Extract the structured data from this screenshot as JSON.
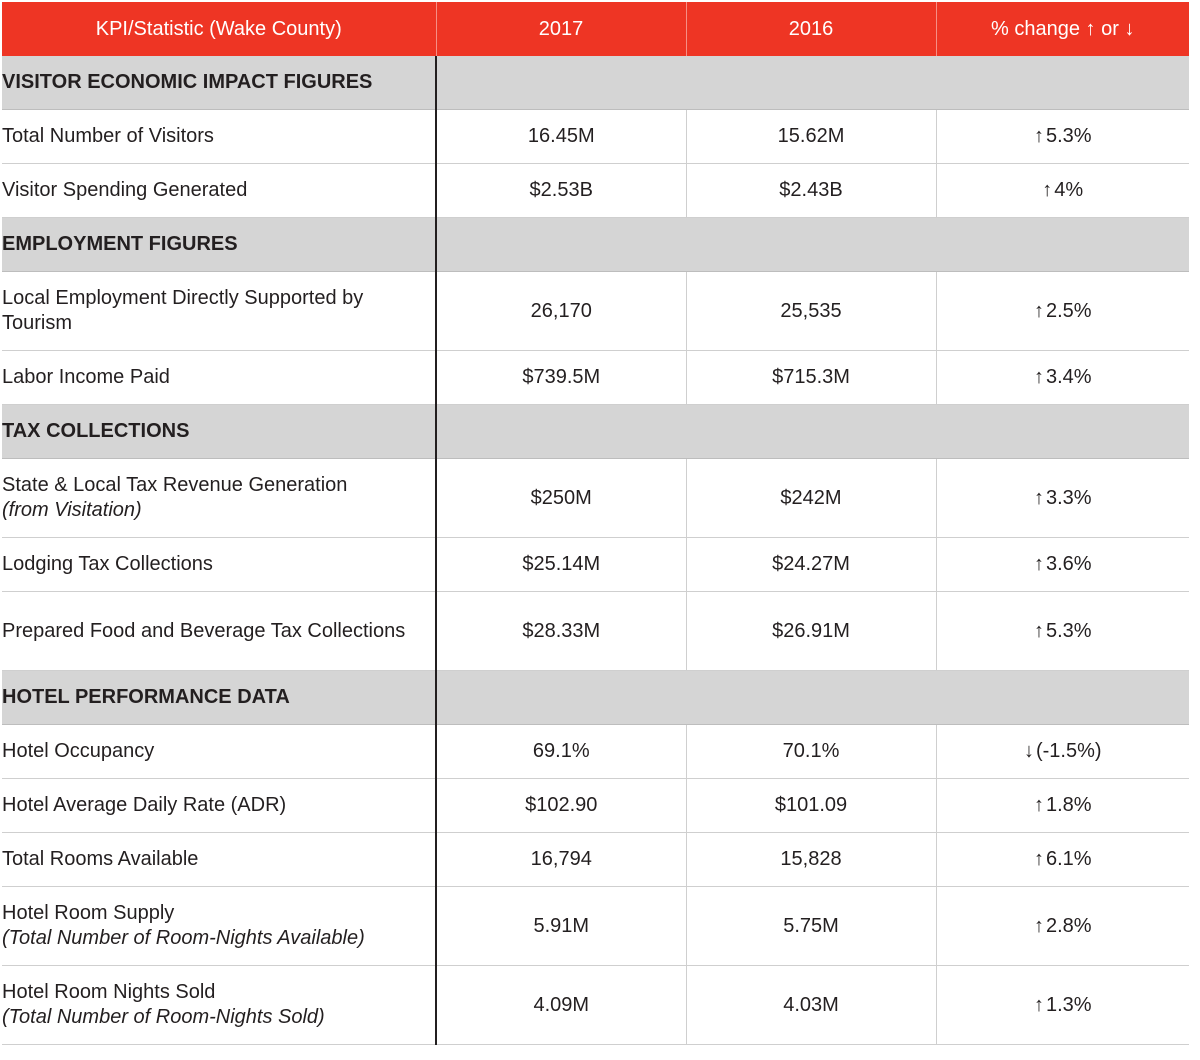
{
  "header": {
    "col_kpi": "KPI/Statistic (Wake County)",
    "col_2017": "2017",
    "col_2016": "2016",
    "col_change": "% change ↑ or ↓"
  },
  "sections": [
    {
      "title": "VISITOR ECONOMIC IMPACT FIGURES",
      "rows": [
        {
          "label": "Total Number of Visitors",
          "sub": "",
          "v2017": "16.45M",
          "v2016": "15.62M",
          "arrow": "↑",
          "change": "5.3%"
        },
        {
          "label": "Visitor Spending Generated",
          "sub": "",
          "v2017": "$2.53B",
          "v2016": "$2.43B",
          "arrow": "↑",
          "change": "4%"
        }
      ]
    },
    {
      "title": "EMPLOYMENT FIGURES",
      "rows": [
        {
          "label": "Local Employment Directly Supported by Tourism",
          "sub": "",
          "v2017": "26,170",
          "v2016": "25,535",
          "arrow": "↑",
          "change": "2.5%"
        },
        {
          "label": "Labor Income Paid",
          "sub": "",
          "v2017": "$739.5M",
          "v2016": "$715.3M",
          "arrow": "↑",
          "change": "3.4%"
        }
      ]
    },
    {
      "title": "TAX COLLECTIONS",
      "rows": [
        {
          "label": "State & Local Tax Revenue Generation",
          "sub": "(from Visitation)",
          "v2017": "$250M",
          "v2016": "$242M",
          "arrow": "↑",
          "change": "3.3%"
        },
        {
          "label": "Lodging Tax Collections",
          "sub": "",
          "v2017": "$25.14M",
          "v2016": "$24.27M",
          "arrow": "↑",
          "change": "3.6%"
        },
        {
          "label": "Prepared Food and Beverage Tax Collections",
          "sub": "",
          "v2017": "$28.33M",
          "v2016": "$26.91M",
          "arrow": "↑",
          "change": "5.3%"
        }
      ]
    },
    {
      "title": "HOTEL PERFORMANCE DATA",
      "rows": [
        {
          "label": "Hotel Occupancy",
          "sub": "",
          "v2017": "69.1%",
          "v2016": "70.1%",
          "arrow": "↓",
          "change": "(-1.5%)"
        },
        {
          "label": "Hotel Average Daily Rate (ADR)",
          "sub": "",
          "v2017": "$102.90",
          "v2016": "$101.09",
          "arrow": "↑",
          "change": "1.8%"
        },
        {
          "label": "Total Rooms Available",
          "sub": "",
          "v2017": "16,794",
          "v2016": "15,828",
          "arrow": "↑",
          "change": "6.1%"
        },
        {
          "label": "Hotel Room Supply",
          "sub": "(Total Number of Room-Nights Available)",
          "v2017": "5.91M",
          "v2016": "5.75M",
          "arrow": "↑",
          "change": "2.8%"
        },
        {
          "label": "Hotel Room Nights Sold",
          "sub": "(Total Number of Room-Nights Sold)",
          "v2017": "4.09M",
          "v2016": "4.03M",
          "arrow": "↑",
          "change": "1.3%"
        }
      ]
    }
  ]
}
